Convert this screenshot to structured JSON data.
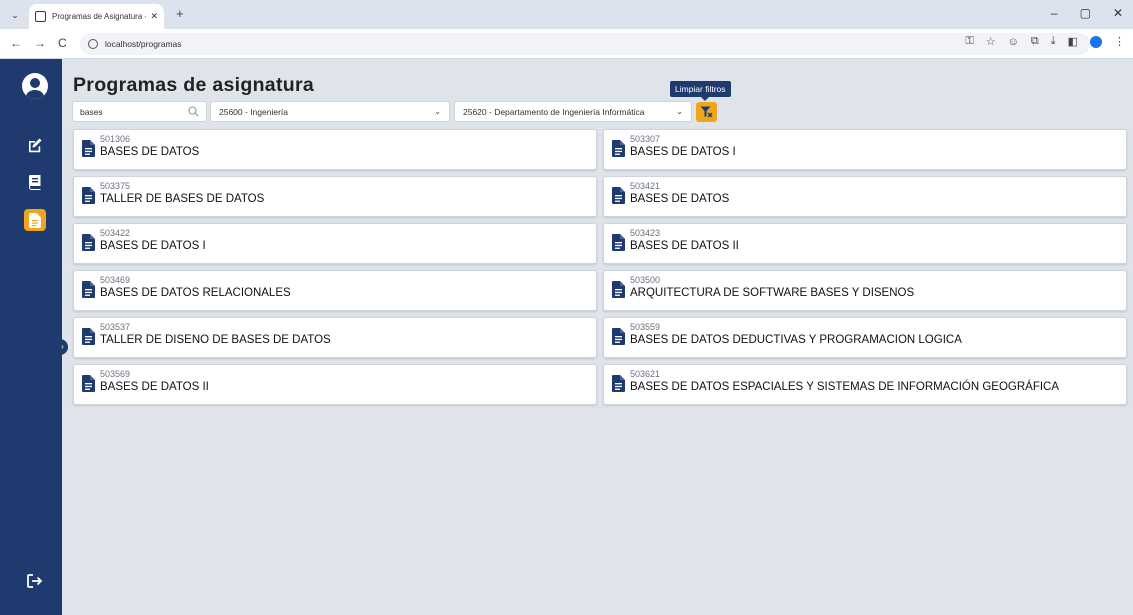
{
  "browser": {
    "tab_title": "Programas de Asignatura - Sist",
    "tab_close": "✕",
    "new_tab": "+",
    "url": "localhost/programas",
    "back": "←",
    "forward": "→",
    "reload": "C",
    "window_controls": [
      "–",
      "▢",
      "✕"
    ]
  },
  "sidebar": {
    "items": [
      {
        "icon": "edit-icon",
        "active": false
      },
      {
        "icon": "book-icon",
        "active": false
      },
      {
        "icon": "document-icon",
        "active": true
      }
    ],
    "logout_icon": "logout-icon",
    "collapse_arrow": "›"
  },
  "page": {
    "title": "Programas de asignatura"
  },
  "filters": {
    "search_value": "bases",
    "facultad": "25600 - Ingeniería",
    "departamento": "25620 - Departamento de Ingeniería Informática",
    "clear_tooltip": "Limpiar filtros"
  },
  "colors": {
    "brand_dark": "#1e3a6e",
    "accent": "#f0a51b",
    "background": "#dfe3ea"
  },
  "programas": [
    {
      "code": "501306",
      "name": "BASES DE DATOS"
    },
    {
      "code": "503307",
      "name": "BASES DE DATOS I"
    },
    {
      "code": "503375",
      "name": "TALLER DE BASES DE DATOS"
    },
    {
      "code": "503421",
      "name": "BASES DE DATOS"
    },
    {
      "code": "503422",
      "name": "BASES DE DATOS I"
    },
    {
      "code": "503423",
      "name": "BASES DE DATOS II"
    },
    {
      "code": "503469",
      "name": "BASES DE DATOS RELACIONALES"
    },
    {
      "code": "503500",
      "name": "ARQUITECTURA DE SOFTWARE BASES Y DISENOS"
    },
    {
      "code": "503537",
      "name": "TALLER DE DISENO DE BASES DE DATOS"
    },
    {
      "code": "503559",
      "name": "BASES DE DATOS DEDUCTIVAS Y PROGRAMACION LOGICA"
    },
    {
      "code": "503569",
      "name": "BASES DE DATOS II"
    },
    {
      "code": "503621",
      "name": "BASES DE DATOS ESPACIALES Y SISTEMAS DE INFORMACIÓN GEOGRÁFICA"
    }
  ]
}
